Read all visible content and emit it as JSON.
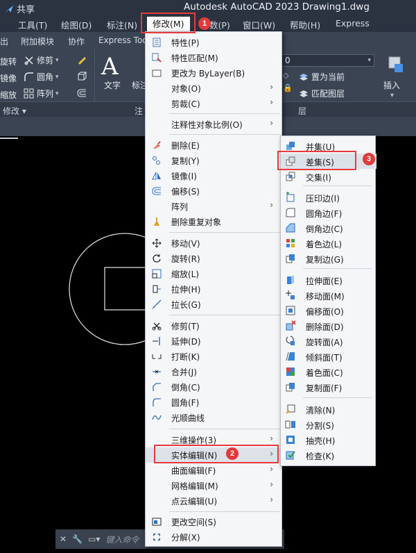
{
  "window": {
    "share_label": "共享",
    "title": "Autodesk AutoCAD 2023     Drawing1.dwg"
  },
  "menubar": {
    "items": [
      {
        "label": "工具(T)"
      },
      {
        "label": "绘图(D)"
      },
      {
        "label": "标注(N)"
      },
      {
        "label": "修改(M)"
      },
      {
        "label": "数(P)"
      },
      {
        "label": "窗口(W)"
      },
      {
        "label": "帮助(H)"
      },
      {
        "label": "Express"
      }
    ]
  },
  "ribbon_tabs": {
    "items": [
      {
        "label": "出"
      },
      {
        "label": "附加模块"
      },
      {
        "label": "协作"
      },
      {
        "label": "Express Too"
      }
    ]
  },
  "ribbon": {
    "rotate": "旋转",
    "trim": "修剪",
    "mirror": "镜像",
    "fillet": "圆角",
    "scale": "缩放",
    "array": "阵列",
    "modify_panel": "修改",
    "text": "文字",
    "dim": "标注",
    "annot_panel": "注",
    "layer_value": "0",
    "set_current": "置为当前",
    "match_layer": "匹配图层",
    "layer_panel": "层",
    "insert": "插入"
  },
  "modify_menu": {
    "items": [
      {
        "label": "特性(P)"
      },
      {
        "label": "特性匹配(M)"
      },
      {
        "label": "更改为 ByLayer(B)"
      },
      {
        "label": "对象(O)"
      },
      {
        "label": "剪裁(C)"
      },
      {
        "label": "注释性对象比例(O)"
      },
      {
        "label": "删除(E)"
      },
      {
        "label": "复制(Y)"
      },
      {
        "label": "镜像(I)"
      },
      {
        "label": "偏移(S)"
      },
      {
        "label": "阵列"
      },
      {
        "label": "删除重复对象"
      },
      {
        "label": "移动(V)"
      },
      {
        "label": "旋转(R)"
      },
      {
        "label": "缩放(L)"
      },
      {
        "label": "拉伸(H)"
      },
      {
        "label": "拉长(G)"
      },
      {
        "label": "修剪(T)"
      },
      {
        "label": "延伸(D)"
      },
      {
        "label": "打断(K)"
      },
      {
        "label": "合并(J)"
      },
      {
        "label": "倒角(C)"
      },
      {
        "label": "圆角(F)"
      },
      {
        "label": "光顺曲线"
      },
      {
        "label": "三维操作(3)"
      },
      {
        "label": "实体编辑(N)"
      },
      {
        "label": "曲面编辑(F)"
      },
      {
        "label": "网格编辑(M)"
      },
      {
        "label": "点云编辑(U)"
      },
      {
        "label": "更改空间(S)"
      },
      {
        "label": "分解(X)"
      }
    ]
  },
  "solid_edit_menu": {
    "items": [
      {
        "label": "并集(U)"
      },
      {
        "label": "差集(S)"
      },
      {
        "label": "交集(I)"
      },
      {
        "label": "压印边(I)"
      },
      {
        "label": "圆角边(F)"
      },
      {
        "label": "倒角边(C)"
      },
      {
        "label": "着色边(L)"
      },
      {
        "label": "复制边(G)"
      },
      {
        "label": "拉伸面(E)"
      },
      {
        "label": "移动面(M)"
      },
      {
        "label": "偏移面(O)"
      },
      {
        "label": "删除面(D)"
      },
      {
        "label": "旋转面(A)"
      },
      {
        "label": "倾斜面(T)"
      },
      {
        "label": "着色面(C)"
      },
      {
        "label": "复制面(F)"
      },
      {
        "label": "清除(N)"
      },
      {
        "label": "分割(S)"
      },
      {
        "label": "抽壳(H)"
      },
      {
        "label": "检查(K)"
      }
    ]
  },
  "callouts": {
    "step1": "1",
    "step2": "2",
    "step3": "3"
  },
  "command_line": {
    "placeholder": "键入命令"
  },
  "colors": {
    "accent_red": "#e23a3a",
    "menu_bg": "#f5f6f7",
    "ribbon_bg": "#3b4453",
    "titlebar_bg": "#2b3240"
  }
}
